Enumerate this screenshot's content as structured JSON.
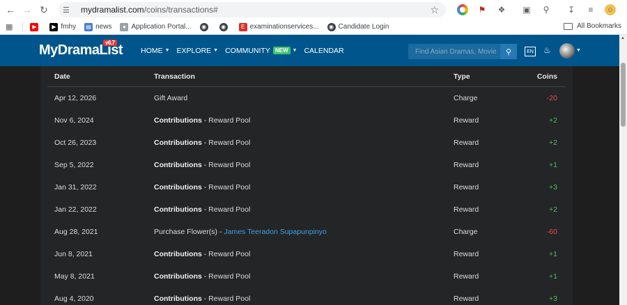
{
  "browser": {
    "url_host": "mydramalist.com",
    "url_path": "/coins/transactions#",
    "bookmarks": [
      {
        "label": "",
        "icon": "youtube-icon",
        "color": "#ff0000"
      },
      {
        "label": "fmhy",
        "icon": "fmhy-icon",
        "color": "#000000"
      },
      {
        "label": "news",
        "icon": "news-icon",
        "color": "#4a7bd0"
      },
      {
        "label": "Application Portal...",
        "icon": "portal-icon",
        "color": "#9aa0a6"
      },
      {
        "label": "",
        "icon": "globe-icon",
        "color": "#3c4043"
      },
      {
        "label": "",
        "icon": "globe-icon",
        "color": "#3c4043"
      },
      {
        "label": "examinationservices...",
        "icon": "exam-icon",
        "color": "#d93025"
      },
      {
        "label": "Candidate Login",
        "icon": "globe-icon",
        "color": "#3c4043"
      }
    ],
    "all_bookmarks": "All Bookmarks"
  },
  "site": {
    "logo": "MyDramaList",
    "version": "v6.7",
    "nav": {
      "home": "HOME",
      "explore": "EXPLORE",
      "community": "COMMUNITY",
      "new_badge": "NEW",
      "calendar": "CALENDAR"
    },
    "search_placeholder": "Find Asian Dramas, Movie",
    "lang": "EN"
  },
  "table": {
    "headers": {
      "date": "Date",
      "transaction": "Transaction",
      "type": "Type",
      "coins": "Coins"
    },
    "rows": [
      {
        "date": "Apr 12, 2026",
        "title": "Gift Award",
        "detail": "",
        "type": "Charge",
        "coins": "-20",
        "kind": "plain"
      },
      {
        "date": "Nov 6, 2024",
        "title": "Contributions",
        "detail": " - Reward Pool",
        "type": "Reward",
        "coins": "+2",
        "kind": "bold"
      },
      {
        "date": "Oct 26, 2023",
        "title": "Contributions",
        "detail": " - Reward Pool",
        "type": "Reward",
        "coins": "+2",
        "kind": "bold"
      },
      {
        "date": "Sep 5, 2022",
        "title": "Contributions",
        "detail": " - Reward Pool",
        "type": "Reward",
        "coins": "+1",
        "kind": "bold"
      },
      {
        "date": "Jan 31, 2022",
        "title": "Contributions",
        "detail": " - Reward Pool",
        "type": "Reward",
        "coins": "+3",
        "kind": "bold"
      },
      {
        "date": "Jan 22, 2022",
        "title": "Contributions",
        "detail": " - Reward Pool",
        "type": "Reward",
        "coins": "+2",
        "kind": "bold"
      },
      {
        "date": "Aug 28, 2021",
        "title": "Purchase Flower(s) - ",
        "detail": "James Teeradon Supapunpinyo",
        "type": "Charge",
        "coins": "-60",
        "kind": "link"
      },
      {
        "date": "Jun 8, 2021",
        "title": "Contributions",
        "detail": " - Reward Pool",
        "type": "Reward",
        "coins": "+1",
        "kind": "bold"
      },
      {
        "date": "May 8, 2021",
        "title": "Contributions",
        "detail": " - Reward Pool",
        "type": "Reward",
        "coins": "+1",
        "kind": "bold"
      },
      {
        "date": "Aug 4, 2020",
        "title": "Contributions",
        "detail": " - Reward Pool",
        "type": "Reward",
        "coins": "+3",
        "kind": "bold"
      }
    ]
  },
  "colors": {
    "header_bg": "#00568c",
    "negative": "#e94b4b",
    "positive": "#4ec066",
    "link": "#3d9ee9"
  }
}
